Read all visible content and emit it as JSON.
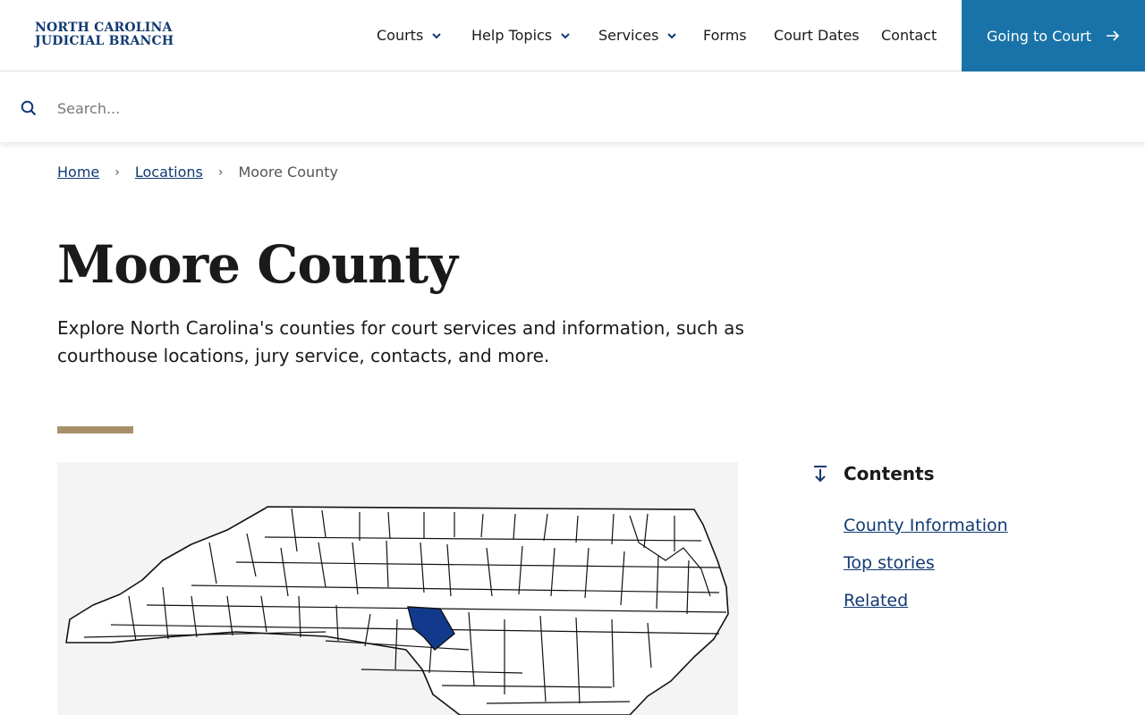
{
  "header": {
    "logo_line1": "NORTH CAROLINA",
    "logo_line2": "JUDICIAL BRANCH",
    "nav": [
      {
        "label": "Courts",
        "has_dropdown": true
      },
      {
        "label": "Help Topics",
        "has_dropdown": true
      },
      {
        "label": "Services",
        "has_dropdown": true
      },
      {
        "label": "Forms",
        "has_dropdown": false
      },
      {
        "label": "Court Dates",
        "has_dropdown": false
      },
      {
        "label": "Contact",
        "has_dropdown": false
      }
    ],
    "cta_label": "Going to Court",
    "cta_color": "#1a73a8"
  },
  "search": {
    "placeholder": "Search..."
  },
  "breadcrumb": {
    "home": "Home",
    "locations": "Locations",
    "current": "Moore County"
  },
  "page": {
    "title": "Moore County",
    "intro": "Explore North Carolina's counties for court services and information, such as courthouse locations, jury service, contacts, and more."
  },
  "map": {
    "highlight_color": "#123a8c"
  },
  "contents": {
    "heading": "Contents",
    "items": [
      "County Information",
      "Top stories",
      "Related"
    ]
  },
  "colors": {
    "brand_navy": "#123a72",
    "accent_tan": "#a68f6a"
  }
}
